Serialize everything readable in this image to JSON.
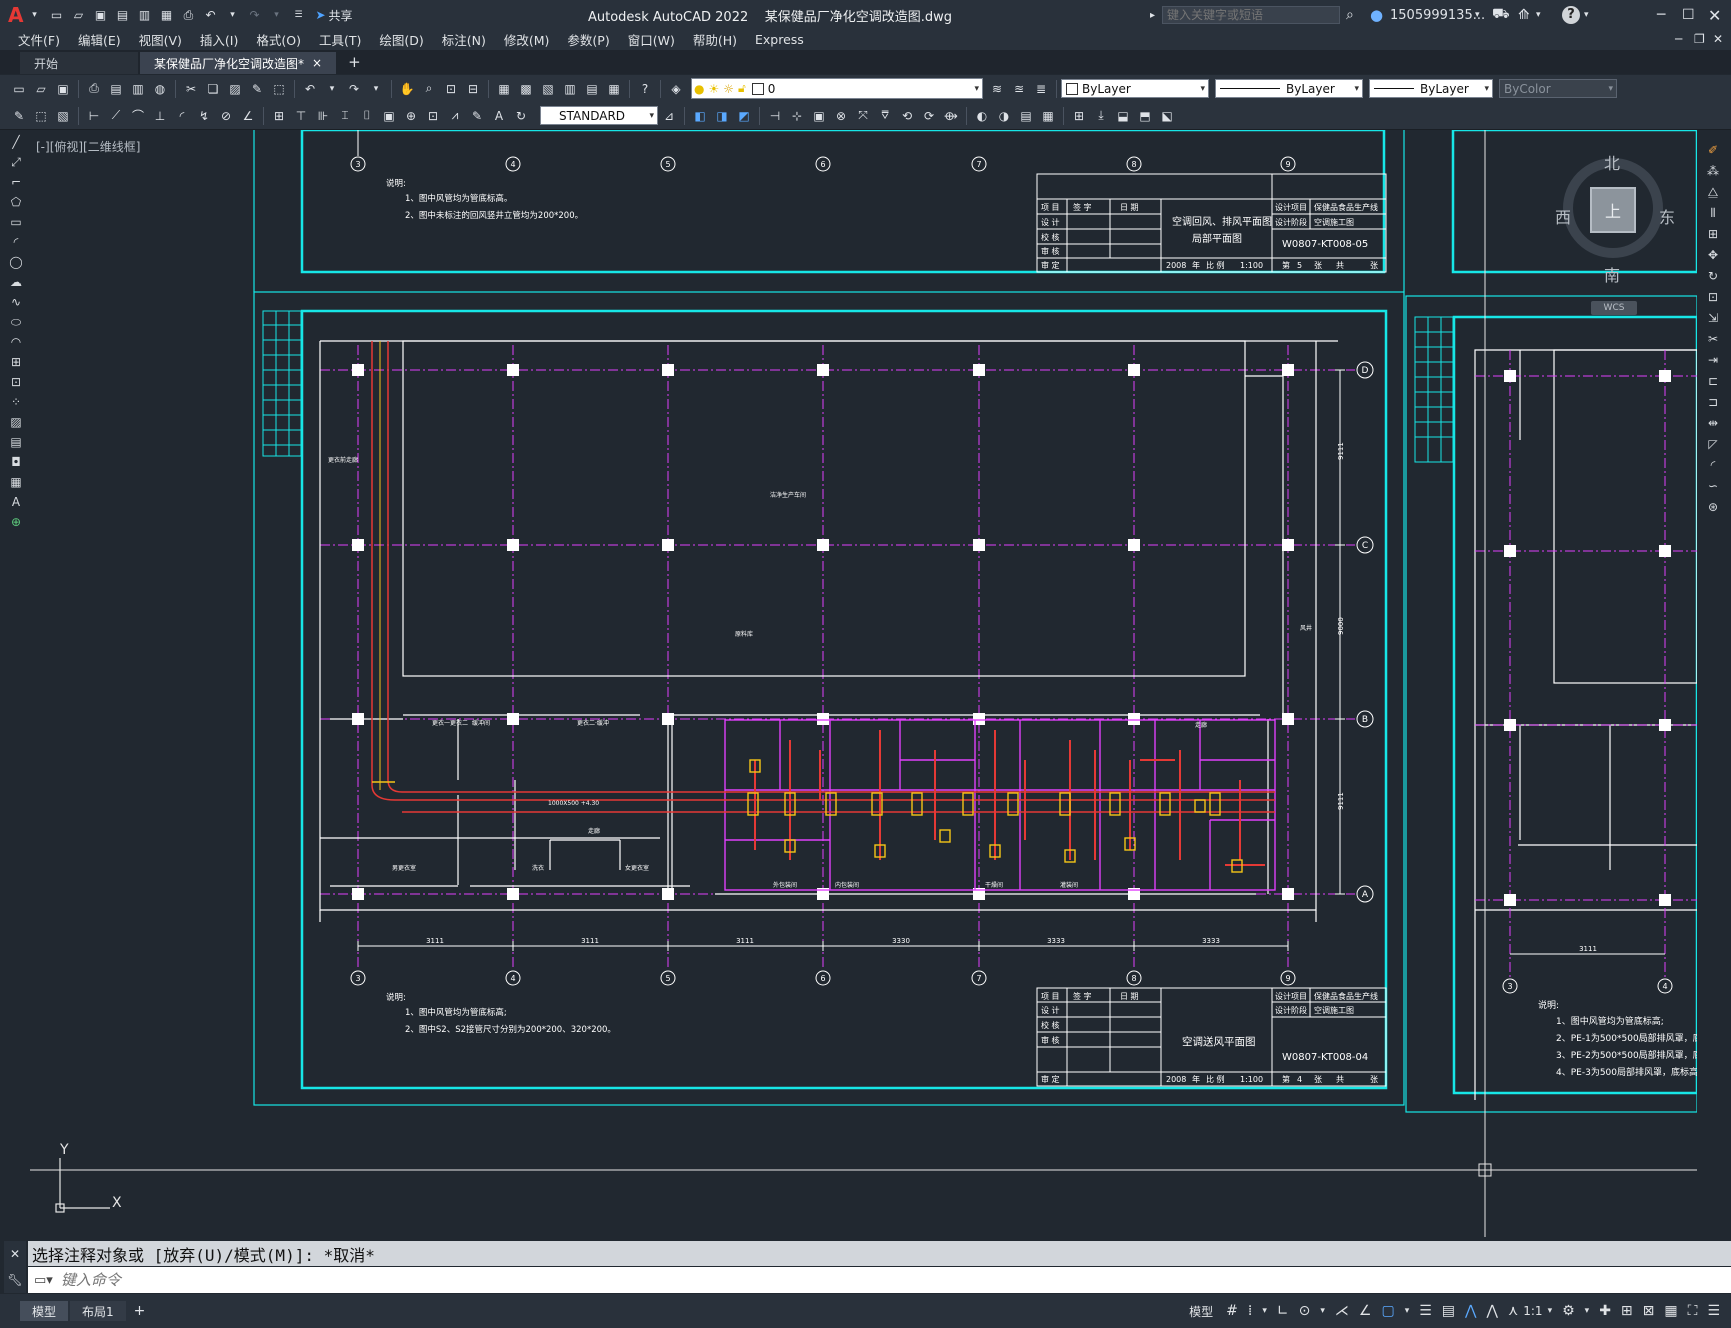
{
  "titlebar": {
    "app_logo": "A",
    "share_label": "共享",
    "title": "Autodesk AutoCAD 2022    某保健品厂净化空调改造图.dwg",
    "search_placeholder": "键入关键字或短语",
    "user": "1505999135...",
    "help": "?"
  },
  "menu": [
    "文件(F)",
    "编辑(E)",
    "视图(V)",
    "插入(I)",
    "格式(O)",
    "工具(T)",
    "绘图(D)",
    "标注(N)",
    "修改(M)",
    "参数(P)",
    "窗口(W)",
    "帮助(H)",
    "Express"
  ],
  "tabs": [
    {
      "label": "开始"
    },
    {
      "label": "某保健品厂净化空调改造图*",
      "close": "×"
    }
  ],
  "new_tab": "+",
  "toolbar": {
    "layer_value": "0",
    "color_value": "ByLayer",
    "linetype_value": "ByLayer",
    "lineweight_value": "ByLayer",
    "plotstyle_value": "ByColor",
    "textstyle_value": "STANDARD"
  },
  "viewport_label": "[-][俯视][二维线框]",
  "viewcube": {
    "north": "北",
    "south": "南",
    "east": "东",
    "west": "西",
    "face": "上",
    "wcs": "WCS"
  },
  "drawing": {
    "grid_cols": [
      "3",
      "4",
      "5",
      "6",
      "7",
      "8",
      "9"
    ],
    "grid_rows": [
      "D",
      "C",
      "B",
      "A"
    ],
    "top_notes": [
      "说明:",
      "1、图中风管均为管底标高。",
      "2、图中未标注的回风竖井立管均为200*200。"
    ],
    "bottom_notes": [
      "说明:",
      "1、图中风管均为管底标高;",
      "2、图中S2、S2接管尺寸分别为200*200、320*200。"
    ],
    "right_notes": [
      "说明:",
      "1、图中风管均为管底标高;",
      "2、PE-1为500*500局部排风罩，底标高+",
      "3、PE-2为500*500局部排风罩，底标高+",
      "4、PE-3为500局部排风罩，底标高+1."
    ],
    "title_block_top": {
      "drawing_name": "空调回风、排风平面图",
      "drawing_name2": "局部平面图",
      "project": "保健品食品生产线",
      "subproject": "空调施工图",
      "drawing_no": "W0807-KT008-05",
      "year": "2008",
      "scale": "1:100",
      "sheet": "5"
    },
    "title_block_bottom": {
      "drawing_name": "空调送风平面图",
      "project": "保健品食品生产线",
      "subproject": "空调施工图",
      "drawing_no": "W0807-KT008-04",
      "year": "2008",
      "scale": "1:100",
      "sheet": "4"
    },
    "tb_labels": [
      "项 目",
      "签 字",
      "日 期",
      "设 计",
      "校 核",
      "审 核",
      "审 定"
    ],
    "tb_right_labels": [
      "设计项目",
      "设计阶段"
    ],
    "tb_bottom_labels": [
      "年",
      "比 例",
      "第",
      "张",
      "共",
      "张"
    ],
    "dims_bottom": [
      "3111",
      "3111",
      "3111",
      "3330",
      "3333",
      "3333"
    ],
    "dims_right": [
      "9111",
      "9000",
      "9111"
    ],
    "duct_label": "1000X500 +4.30",
    "axis_x": "X",
    "axis_y": "Y"
  },
  "command": {
    "history": "选择注释对象或 [放弃(U)/模式(M)]: *取消*",
    "placeholder": "键入命令"
  },
  "layout_tabs": [
    {
      "label": "模型"
    },
    {
      "label": "布局1"
    }
  ],
  "status": {
    "model": "模型",
    "scale": "1:1"
  }
}
